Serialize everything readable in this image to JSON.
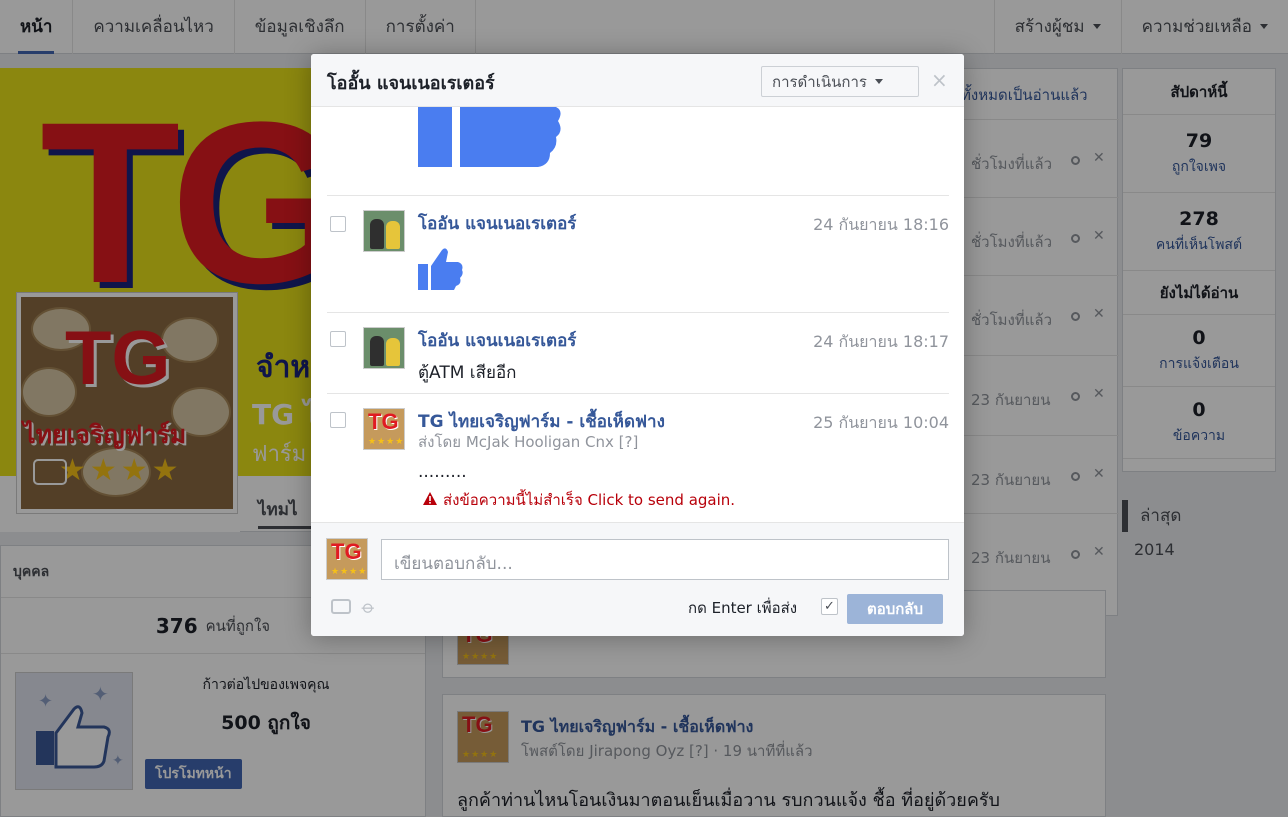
{
  "topnav": {
    "left": [
      "หน้า",
      "ความเคลื่อนไหว",
      "ข้อมูลเชิงลึก",
      "การตั้งค่า"
    ],
    "right": [
      "สร้างผู้ชม",
      "ความช่วยเหลือ"
    ]
  },
  "cover": {
    "logo": "TG",
    "page_name": "จำห",
    "page_sub": "TG ไ",
    "page_sub2": "ฟาร์ม",
    "profile_logo": "TG",
    "profile_text": "ไทยเจริญฟาร์ม",
    "profile_stars": "★★★★",
    "timeline_tab": "ไทมไ"
  },
  "left_card": {
    "header": "บุคคล",
    "likes_count": "376",
    "likes_label": "คนที่ถูกใจ",
    "promo_title": "ก้าวต่อไปของเพจคุณ",
    "promo_count": "500 ถูกใจ",
    "promo_button": "โปรโมทหน้า"
  },
  "notifications": {
    "mark_all": "ทั้งหมดเป็นอ่านแล้ว",
    "rows": [
      "ชั่วโมงที่แล้ว",
      "ชั่วโมงที่แล้ว",
      "ชั่วโมงที่แล้ว",
      "23 กันยายน",
      "23 กันยายน",
      "23 กันยายน"
    ]
  },
  "stats": {
    "this_week": "สัปดาห์นี้",
    "page_likes_n": "79",
    "page_likes_l": "ถูกใจเพจ",
    "post_reach_n": "278",
    "post_reach_l": "คนที่เห็นโพสต์",
    "unread_title": "ยังไม่ได้อ่าน",
    "notif_n": "0",
    "notif_l": "การแจ้งเตือน",
    "msg_n": "0",
    "msg_l": "ข้อความ"
  },
  "year_nav": {
    "latest": "ล่าสุด",
    "year": "2014"
  },
  "posts": [
    {},
    {
      "name": "TG ไทยเจริญฟาร์ม - เชื้อเห็ดฟาง",
      "meta": "โพสต์โดย Jirapong Oyz [?] · 19 นาทีที่แล้ว",
      "body": "ลูกค้าท่านไหนโอนเงินมาตอนเย็นเมื่อวาน รบกวนแจ้ง ชื้อ ที่อยู่ด้วยครับ"
    }
  ],
  "dialog": {
    "title": "โออั้น แจนเนอเรเตอร์",
    "actions_label": "การดำเนินการ",
    "close": "×",
    "messages": [
      {
        "sender": "โออัน แจนเนอเรเตอร์",
        "time": "24 กันยายน 18:16",
        "type": "like"
      },
      {
        "sender": "โออัน แจนเนอเรเตอร์",
        "time": "24 กันยายน 18:17",
        "text": "ตู้ATM เสียอีก"
      },
      {
        "sender": "TG ไทยเจริญฟาร์ม - เชื้อเห็ดฟาง",
        "time": "25 กันยายน 10:04",
        "via": "ส่งโดย McJak Hooligan Cnx [?]",
        "text": ".........",
        "error": "ส่งข้อความนี้ไม่สำเร็จ Click to send again."
      }
    ],
    "reply_placeholder": "เขียนตอบกลับ...",
    "enter_to_send": "กด Enter เพื่อส่ง",
    "enter_checked": "✓",
    "send_button": "ตอบกลับ"
  },
  "colors": {
    "brand_blue": "#4267b2",
    "link_blue": "#365899",
    "error_red": "#b8000a",
    "cover_yellow": "#e8e21a",
    "logo_red": "#e01b22"
  }
}
